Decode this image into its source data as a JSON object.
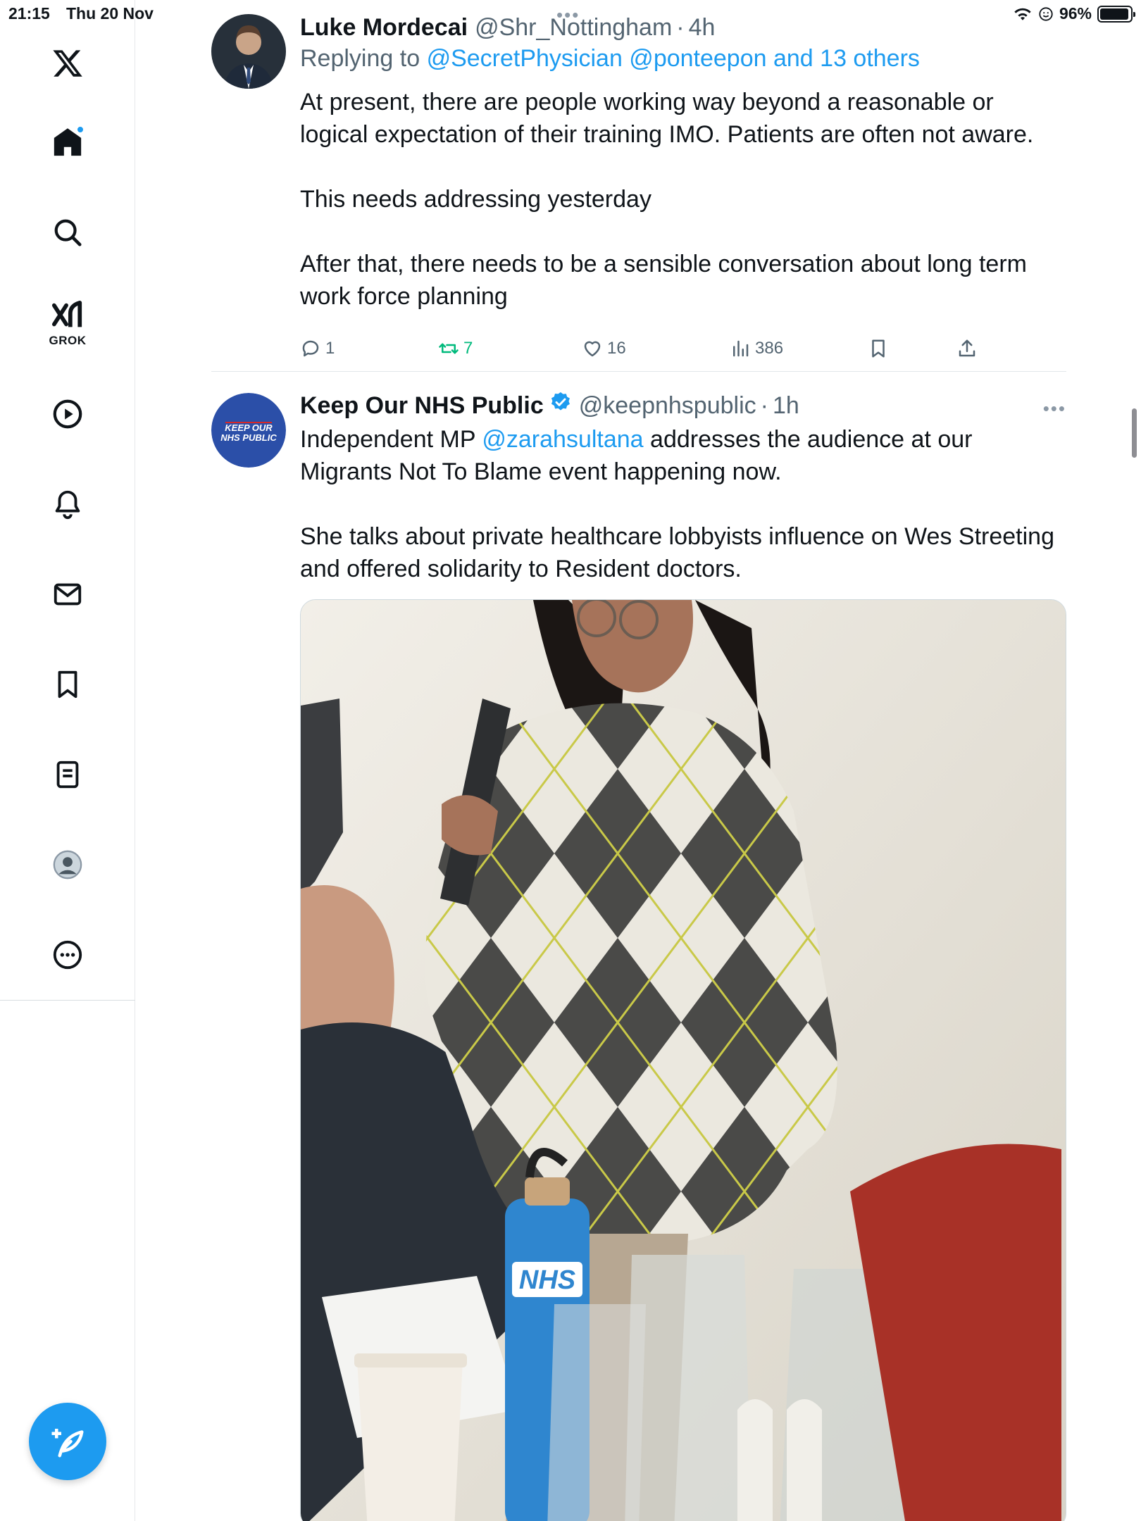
{
  "status_bar": {
    "time": "21:15",
    "date": "Thu 20 Nov",
    "battery": "96%",
    "battery_level": 0.96
  },
  "sidebar": {
    "items": [
      {
        "name": "x-logo"
      },
      {
        "name": "home",
        "has_notification": true
      },
      {
        "name": "search"
      },
      {
        "name": "grok",
        "label": "GROK"
      },
      {
        "name": "videos"
      },
      {
        "name": "notifications"
      },
      {
        "name": "messages"
      },
      {
        "name": "bookmarks"
      },
      {
        "name": "lists"
      },
      {
        "name": "profile"
      },
      {
        "name": "more"
      }
    ],
    "compose_icon": "compose-feather-icon"
  },
  "colors": {
    "accent": "#1d9bf0",
    "text": "#0f1419",
    "secondary": "#536471",
    "retweet_active": "#00ba7c"
  },
  "tweets": [
    {
      "name": "Luke Mordecai",
      "handle": "@Shr_Nottingham",
      "time": "4h",
      "replying_prefix": "Replying to",
      "replying_to": "@SecretPhysician @ponteepon and 13 others",
      "paragraphs": [
        "At present, there are people working way beyond a reasonable or logical expectation of their training IMO. Patients are often not aware.",
        "This needs addressing yesterday",
        "After that, there needs to be a sensible conversation about long term work force planning"
      ],
      "stats": {
        "replies": "1",
        "retweets": "7",
        "likes": "16",
        "views": "386"
      }
    },
    {
      "name": "Keep Our NHS Public",
      "handle": "@keepnhspublic",
      "time": "1h",
      "verified": true,
      "avatar_text": "KEEP OUR NHS PUBLIC",
      "body_line1_pre": "Independent MP",
      "body_mention": "@zarahsultana",
      "body_line1_post": "addresses the audience at our Migrants Not To Blame event happening now.",
      "paragraph2": "She talks about private healthcare lobbyists influence on Wes Streeting and offered solidarity to Resident doctors.",
      "media": {
        "description": "photo",
        "bottle_text": "NHS"
      }
    }
  ]
}
